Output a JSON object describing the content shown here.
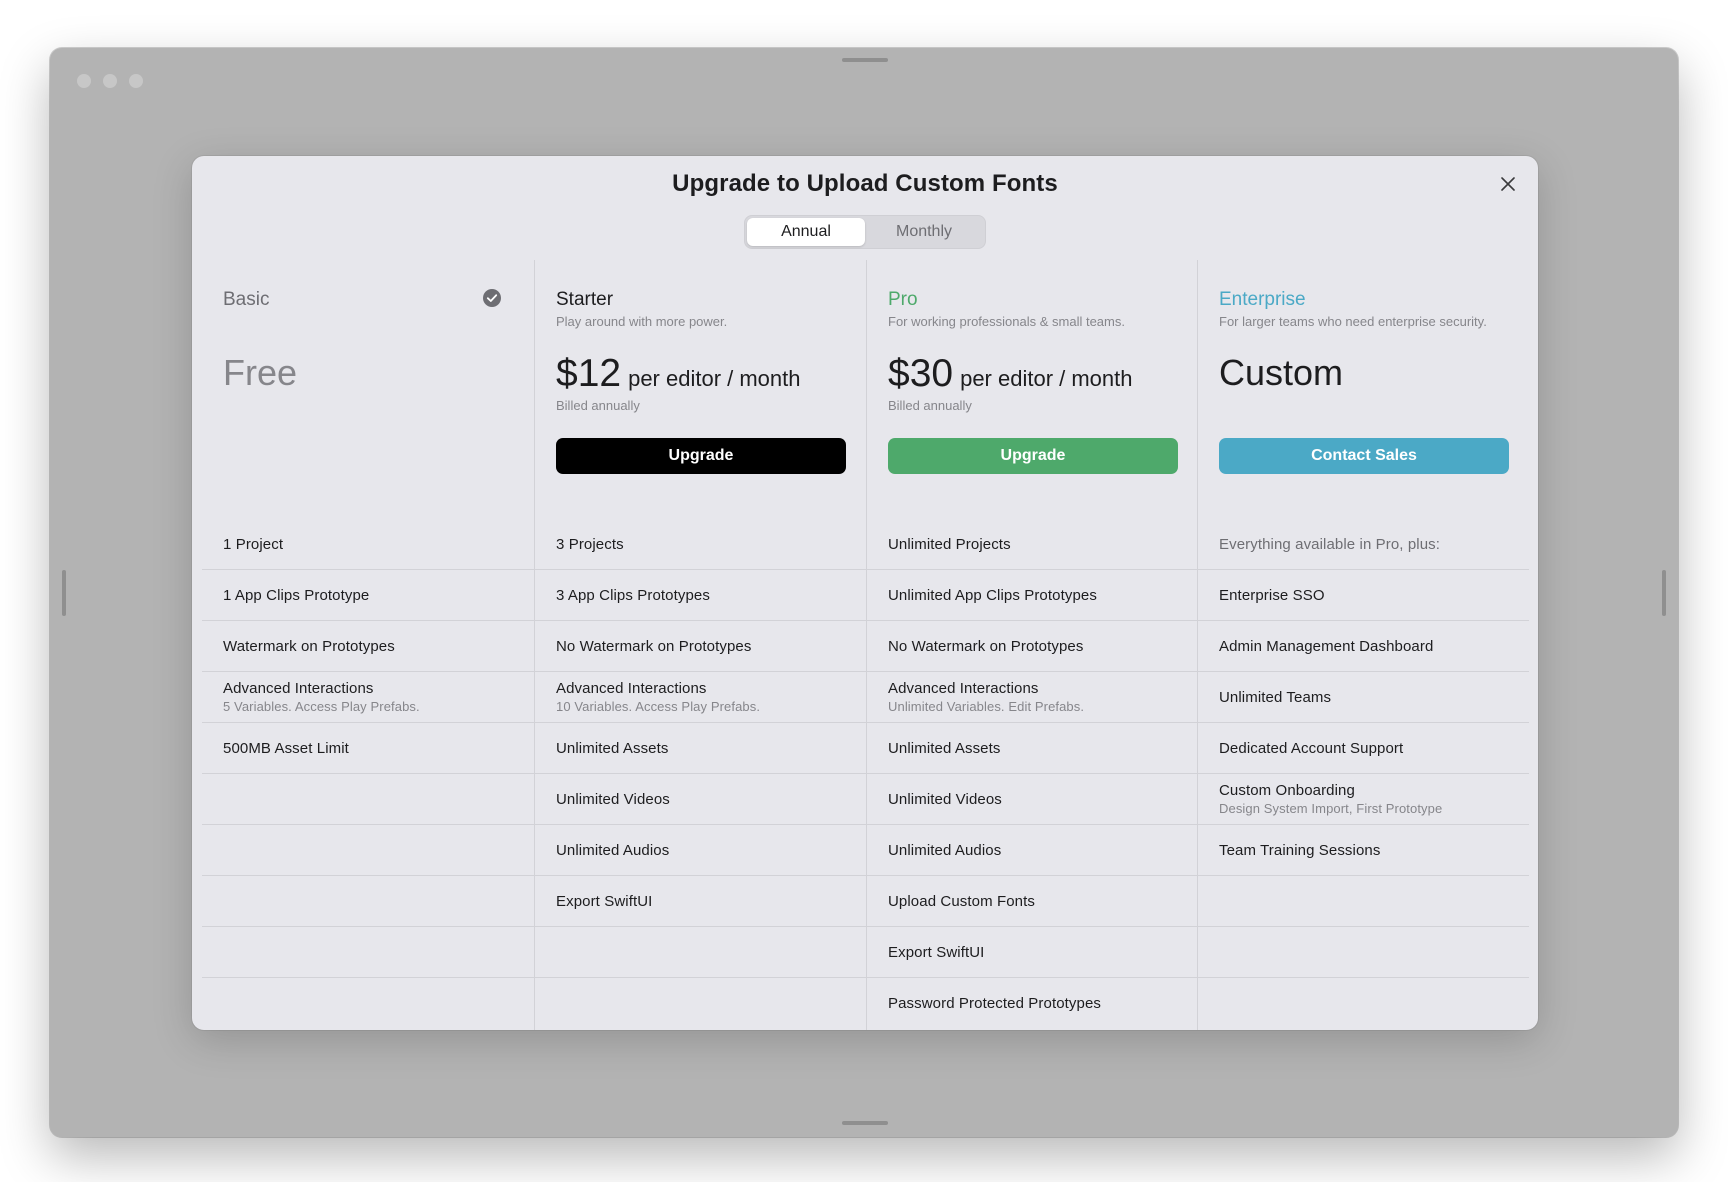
{
  "modal": {
    "title": "Upgrade to Upload Custom Fonts",
    "billing_toggle": {
      "options": [
        "Annual",
        "Monthly"
      ],
      "selected": "Annual"
    }
  },
  "colors": {
    "starter_button": "#000000",
    "pro_accent": "#4ea96b",
    "enterprise_accent": "#4ba9c6",
    "basic_name": "#6e6e73"
  },
  "plans": [
    {
      "name": "Basic",
      "description": "",
      "price": "Free",
      "price_unit": "",
      "billed": "",
      "cta": "",
      "current": true,
      "features": [
        {
          "main": "1 Project",
          "sub": ""
        },
        {
          "main": "1 App Clips Prototype",
          "sub": ""
        },
        {
          "main": "Watermark on Prototypes",
          "sub": ""
        },
        {
          "main": "Advanced Interactions",
          "sub": "5 Variables. Access Play Prefabs."
        },
        {
          "main": "500MB Asset Limit",
          "sub": ""
        },
        {
          "main": "",
          "sub": ""
        },
        {
          "main": "",
          "sub": ""
        },
        {
          "main": "",
          "sub": ""
        },
        {
          "main": "",
          "sub": ""
        },
        {
          "main": "",
          "sub": ""
        }
      ]
    },
    {
      "name": "Starter",
      "description": "Play around with more power.",
      "price": "$12",
      "price_unit": "per editor / month",
      "billed": "Billed annually",
      "cta": "Upgrade",
      "current": false,
      "features": [
        {
          "main": "3 Projects",
          "sub": ""
        },
        {
          "main": "3 App Clips Prototypes",
          "sub": ""
        },
        {
          "main": "No Watermark on Prototypes",
          "sub": ""
        },
        {
          "main": "Advanced Interactions",
          "sub": "10 Variables. Access Play Prefabs."
        },
        {
          "main": "Unlimited Assets",
          "sub": ""
        },
        {
          "main": "Unlimited Videos",
          "sub": ""
        },
        {
          "main": "Unlimited Audios",
          "sub": ""
        },
        {
          "main": "Export SwiftUI",
          "sub": ""
        },
        {
          "main": "",
          "sub": ""
        },
        {
          "main": "",
          "sub": ""
        }
      ]
    },
    {
      "name": "Pro",
      "description": "For working professionals & small teams.",
      "price": "$30",
      "price_unit": "per editor / month",
      "billed": "Billed annually",
      "cta": "Upgrade",
      "current": false,
      "features": [
        {
          "main": "Unlimited Projects",
          "sub": ""
        },
        {
          "main": "Unlimited App Clips Prototypes",
          "sub": ""
        },
        {
          "main": "No Watermark on Prototypes",
          "sub": ""
        },
        {
          "main": "Advanced Interactions",
          "sub": "Unlimited Variables. Edit Prefabs."
        },
        {
          "main": "Unlimited Assets",
          "sub": ""
        },
        {
          "main": "Unlimited Videos",
          "sub": ""
        },
        {
          "main": "Unlimited Audios",
          "sub": ""
        },
        {
          "main": "Upload Custom Fonts",
          "sub": ""
        },
        {
          "main": "Export SwiftUI",
          "sub": ""
        },
        {
          "main": "Password Protected Prototypes",
          "sub": ""
        }
      ]
    },
    {
      "name": "Enterprise",
      "description": "For larger teams who need enterprise security.",
      "price": "Custom",
      "price_unit": "",
      "billed": "",
      "cta": "Contact Sales",
      "current": false,
      "features": [
        {
          "main": "Everything available in Pro, plus:",
          "sub": ""
        },
        {
          "main": "Enterprise SSO",
          "sub": ""
        },
        {
          "main": "Admin Management Dashboard",
          "sub": ""
        },
        {
          "main": "Unlimited Teams",
          "sub": ""
        },
        {
          "main": "Dedicated Account Support",
          "sub": ""
        },
        {
          "main": "Custom Onboarding",
          "sub": "Design System Import, First Prototype"
        },
        {
          "main": "Team Training Sessions",
          "sub": ""
        },
        {
          "main": "",
          "sub": ""
        },
        {
          "main": "",
          "sub": ""
        },
        {
          "main": "",
          "sub": ""
        }
      ]
    }
  ]
}
